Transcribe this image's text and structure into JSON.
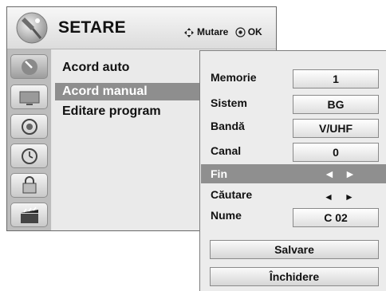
{
  "header": {
    "title": "SETARE",
    "move_hint": "Mutare",
    "ok_hint": "OK"
  },
  "sidebar": {
    "icons": [
      "settings-wand-icon",
      "screen-icon",
      "speaker-icon",
      "clock-icon",
      "lock-icon",
      "clapper-icon"
    ],
    "active_index": 0
  },
  "submenu": {
    "items": [
      "Acord auto",
      "Acord manual",
      "Editare program"
    ],
    "selected_index": 1
  },
  "panel": {
    "fields": [
      {
        "label": "Memorie",
        "value": "1"
      },
      {
        "label": "Sistem",
        "value": "BG"
      },
      {
        "label": "Bandă",
        "value": "V/UHF"
      },
      {
        "label": "Canal",
        "value": "0"
      },
      {
        "label": "Fin",
        "value": ""
      },
      {
        "label": "Căutare",
        "value": ""
      },
      {
        "label": "Nume",
        "value": "C  02"
      }
    ],
    "arrows": {
      "left": "◄",
      "right": "►"
    },
    "save_label": "Salvare",
    "close_label": "Închidere"
  },
  "colors": {
    "highlight": "#8e8e8e",
    "sidebar": "#bdbdbd"
  }
}
